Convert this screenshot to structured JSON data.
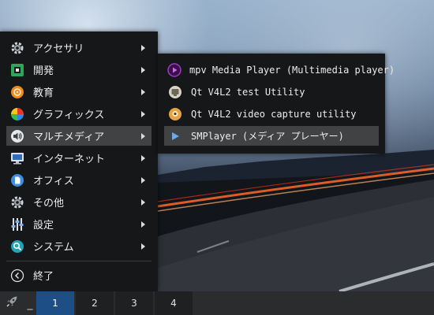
{
  "menu": {
    "items": [
      {
        "label": "アクセサリ",
        "icon": "accessories-gear-icon",
        "has_submenu": true
      },
      {
        "label": "開発",
        "icon": "development-chip-icon",
        "has_submenu": true
      },
      {
        "label": "教育",
        "icon": "education-icon",
        "has_submenu": true
      },
      {
        "label": "グラフィックス",
        "icon": "graphics-color-icon",
        "has_submenu": true
      },
      {
        "label": "マルチメディア",
        "icon": "multimedia-speaker-icon",
        "has_submenu": true,
        "active": true
      },
      {
        "label": "インターネット",
        "icon": "internet-monitor-icon",
        "has_submenu": true
      },
      {
        "label": "オフィス",
        "icon": "office-document-icon",
        "has_submenu": true
      },
      {
        "label": "その他",
        "icon": "other-gear-icon",
        "has_submenu": true
      },
      {
        "label": "設定",
        "icon": "settings-sliders-icon",
        "has_submenu": true
      },
      {
        "label": "システム",
        "icon": "system-search-icon",
        "has_submenu": true
      }
    ],
    "quit_label": "終了"
  },
  "submenu": {
    "items": [
      {
        "label": "mpv Media Player (Multimedia player)",
        "icon": "mpv-play-icon"
      },
      {
        "label": "Qt V4L2 test Utility",
        "icon": "qv4l2-tv-icon"
      },
      {
        "label": "Qt V4L2 video capture utility",
        "icon": "qvidcap-webcam-icon"
      },
      {
        "label": "SMPlayer (メディア プレーヤー)",
        "icon": "smplayer-play-icon",
        "active": true
      }
    ]
  },
  "taskbar": {
    "underscore": "_",
    "workspaces": [
      "1",
      "2",
      "3",
      "4"
    ],
    "active_workspace": "1"
  },
  "colors": {
    "menu_bg": "#151718",
    "active_bg": "#404244",
    "taskbar_bg": "#2a2c2e",
    "active_workspace": "#1d4f86"
  }
}
